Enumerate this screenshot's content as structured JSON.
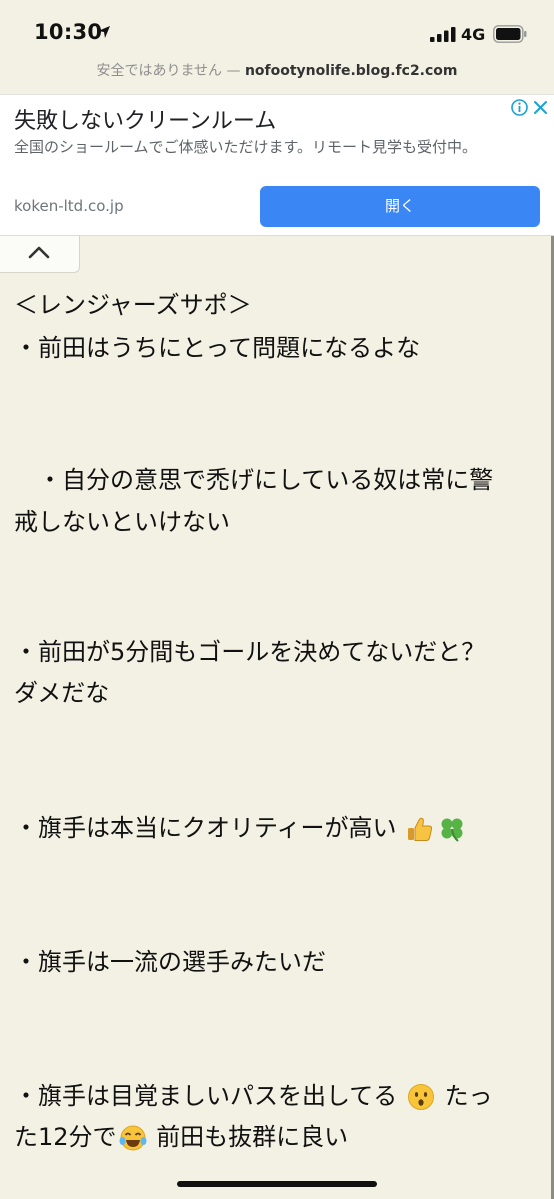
{
  "status": {
    "time": "10:30",
    "network": "4G"
  },
  "url": {
    "warning": "安全ではありません — ",
    "host": "nofootynolife.blog.fc2.com"
  },
  "ad": {
    "title": "失敗しないクリーンルーム",
    "description": "全国のショールームでご体感いただけます。リモート見学も受付中。",
    "domain": "koken-ltd.co.jp",
    "open_button": "開く"
  },
  "article": {
    "lines": [
      "＜レンジャーズサポ＞",
      "・前田はうちにとって問題になるよな",
      "　・自分の意思で禿げにしている奴は常に警",
      "戒しないといけない",
      "・前田が5分間もゴールを決めてないだと？",
      "ダメだな",
      "・旗手は本当にクオリティーが高い",
      "・旗手は一流の選手みたいだ",
      "・旗手は目覚ましいパスを出してる",
      "たっ",
      "た12分で",
      "前田も抜群に良い"
    ]
  },
  "icons": {
    "thumbs_up": "thumbs-up-emoji",
    "clover": "four-leaf-clover-emoji",
    "surprised": "hushed-face-emoji",
    "laughing": "tears-of-joy-emoji"
  }
}
